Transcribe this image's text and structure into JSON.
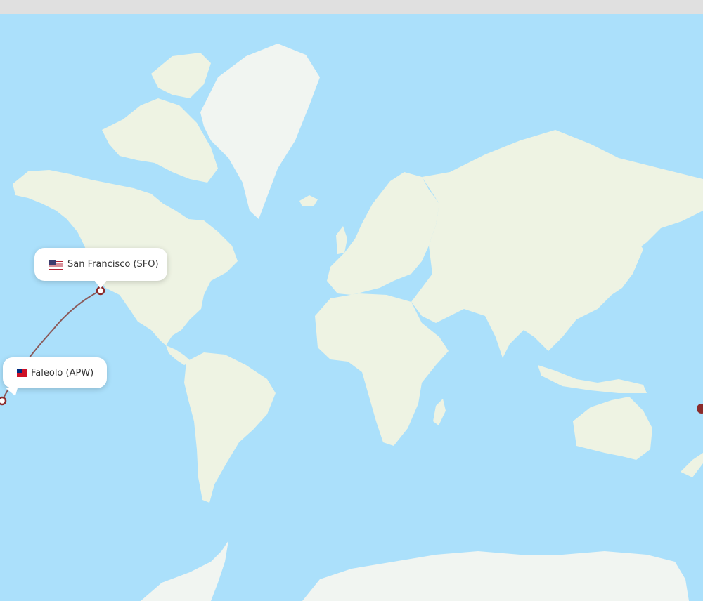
{
  "colors": {
    "ocean": "#abe0fb",
    "land": "#eef3e3",
    "polar": "#f1f5f1",
    "route": "#8b5a5a",
    "marker": "#8b2b2b",
    "topbar": "#e0e0e0"
  },
  "route": {
    "origin": {
      "label": "San Francisco (SFO)",
      "flag_icon": "us-flag-icon"
    },
    "destination": {
      "label": "Faleolo (APW)",
      "flag_icon": "samoa-flag-icon"
    }
  }
}
